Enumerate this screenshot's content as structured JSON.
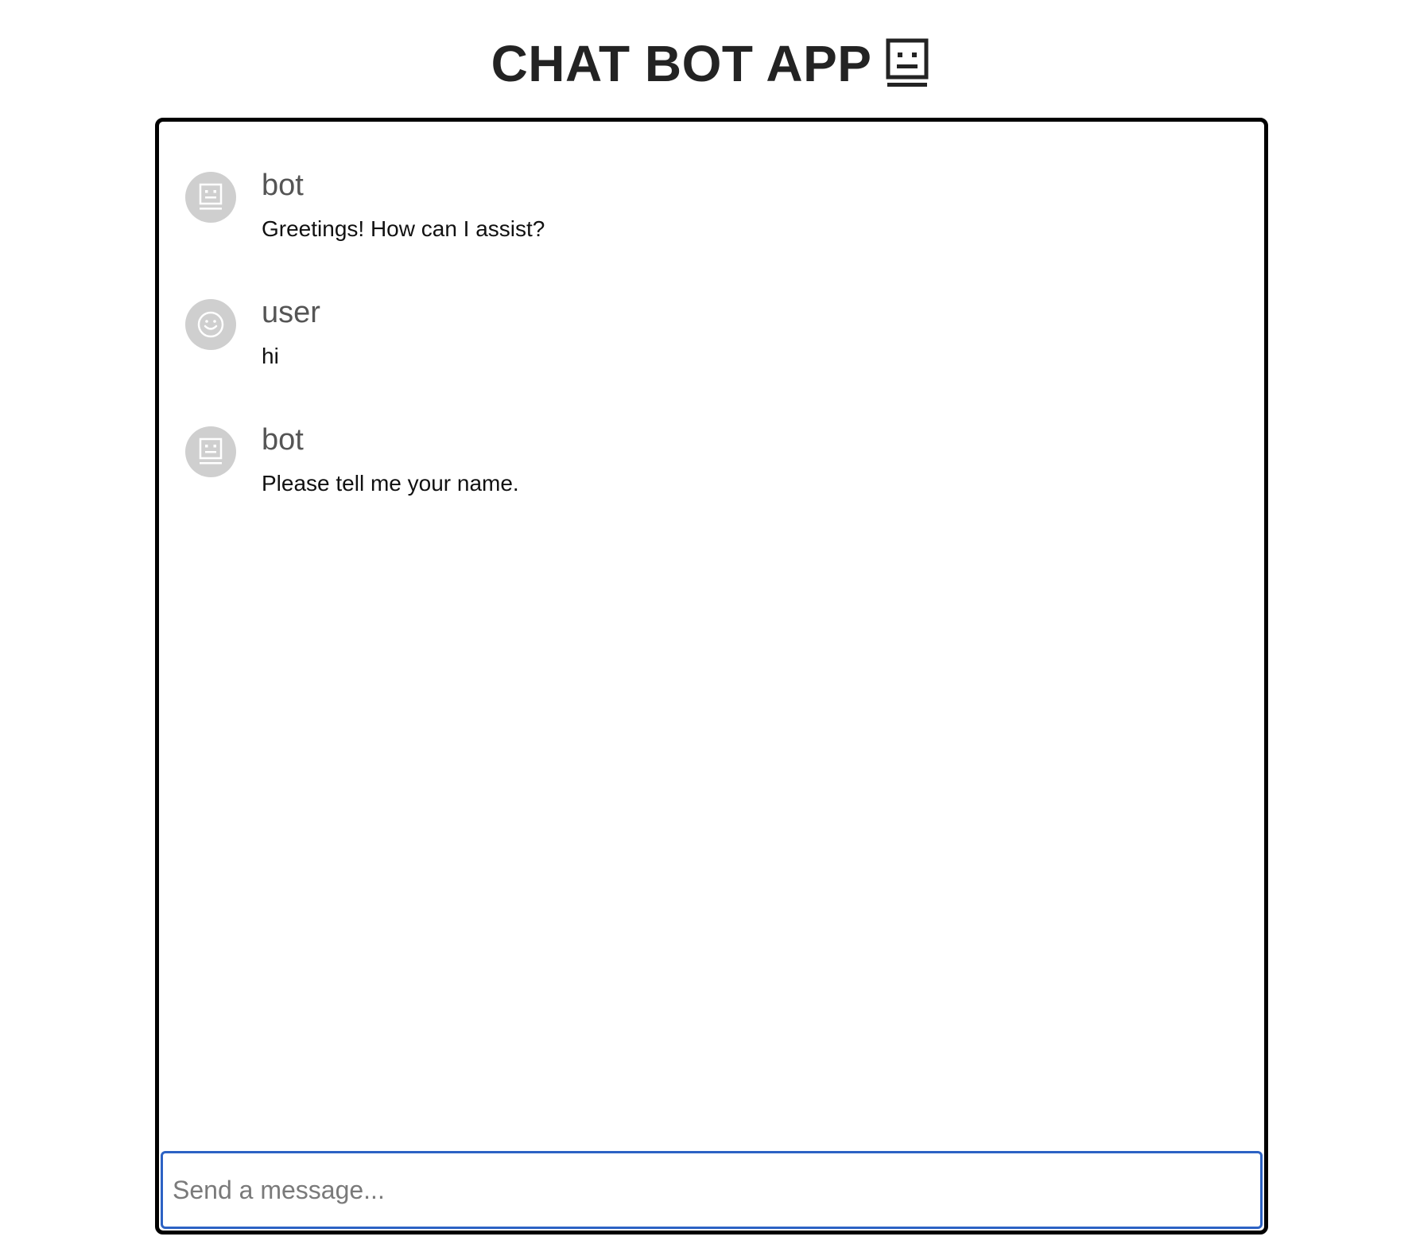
{
  "header": {
    "title": "CHAT BOT APP",
    "title_icon": "robot-face-icon"
  },
  "messages": [
    {
      "sender": "bot",
      "text": "Greetings! How can I assist?",
      "avatar_icon": "robot-icon"
    },
    {
      "sender": "user",
      "text": "hi",
      "avatar_icon": "smiley-icon"
    },
    {
      "sender": "bot",
      "text": "Please tell me your name.",
      "avatar_icon": "robot-icon"
    }
  ],
  "composer": {
    "placeholder": "Send a message...",
    "value": ""
  },
  "colors": {
    "frame_border": "#000000",
    "input_focus_border": "#2c62c4",
    "avatar_bg": "#cfcfcf",
    "sender_text": "#555555"
  }
}
